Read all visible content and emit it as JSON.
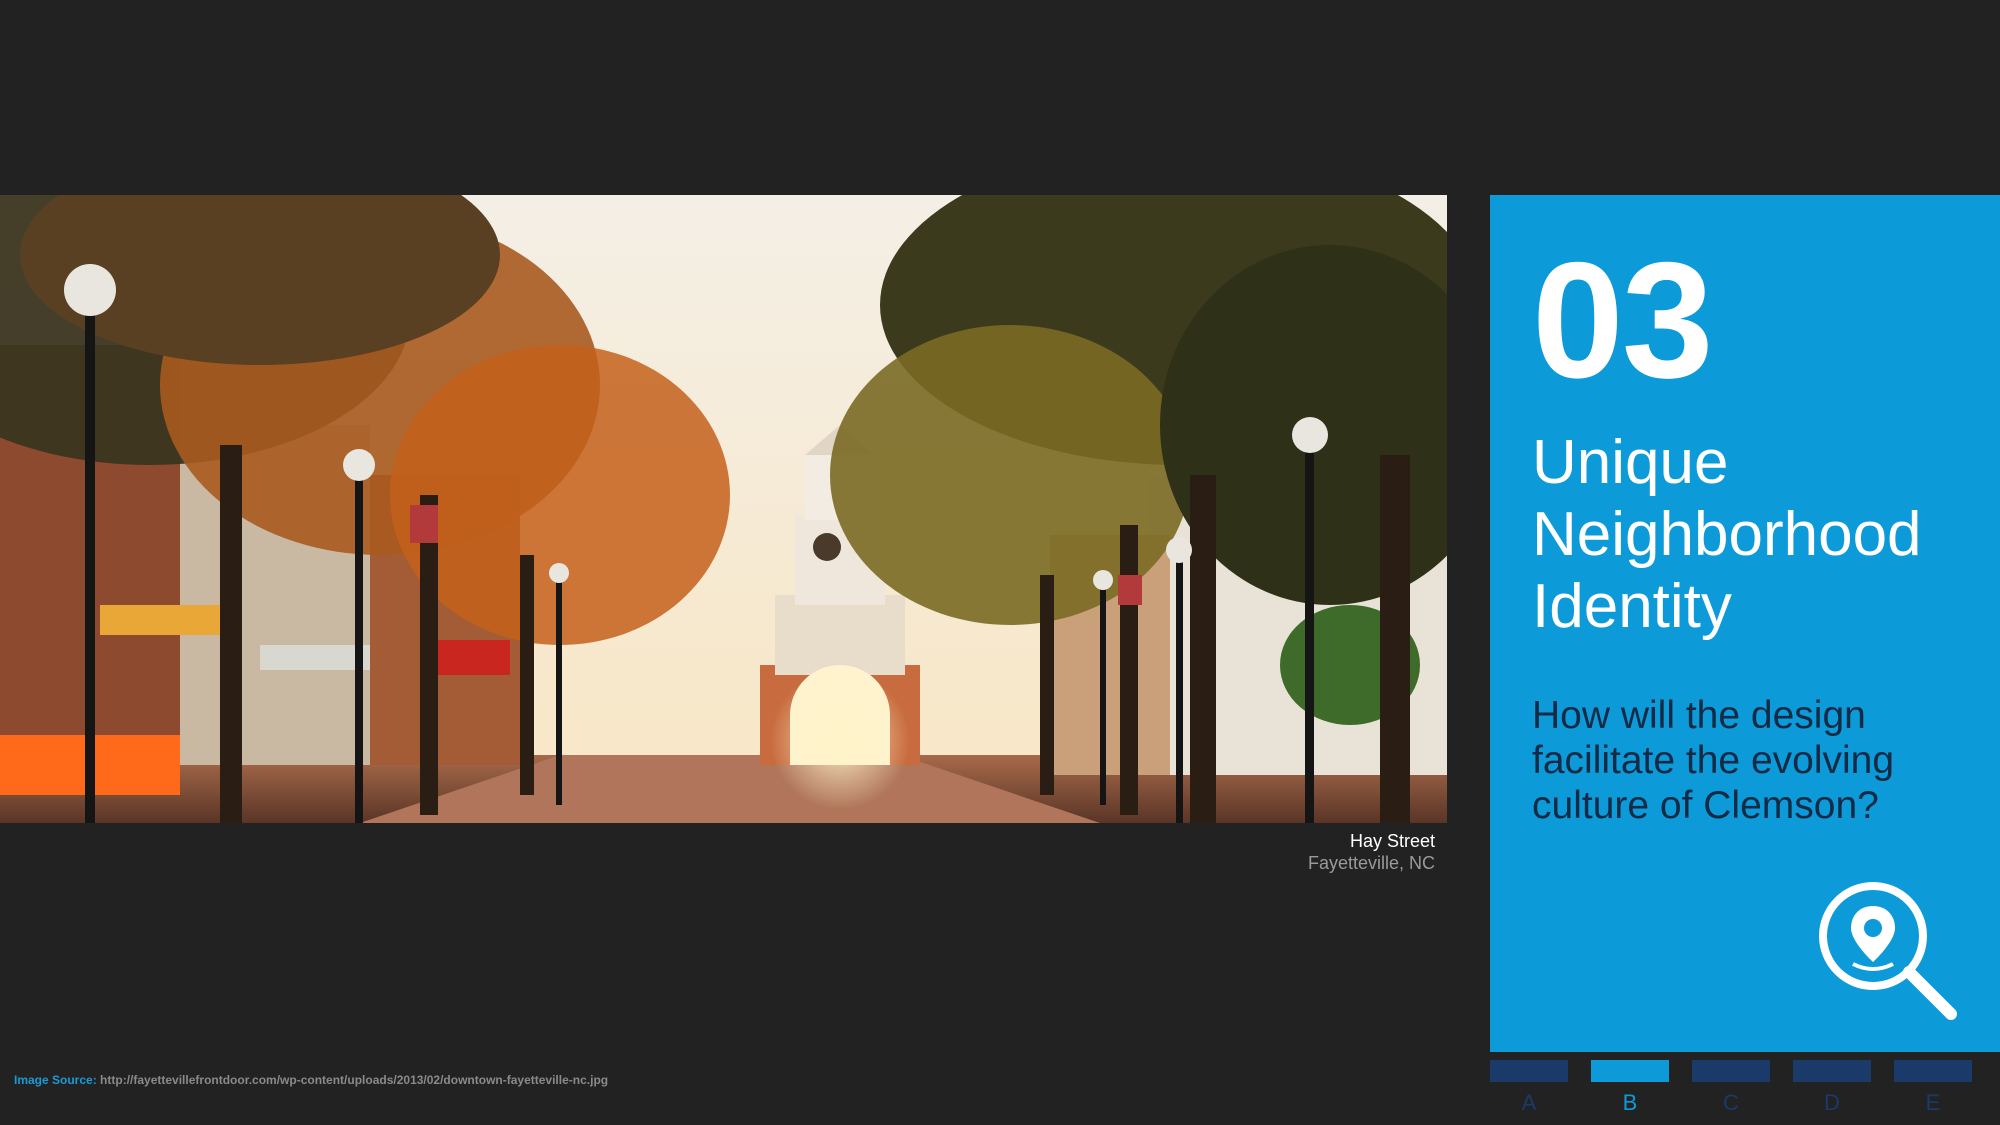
{
  "photo": {
    "alt_subject": "tree-lined street with clock tower"
  },
  "caption": {
    "title": "Hay Street",
    "subtitle": "Fayetteville, NC"
  },
  "panel": {
    "number": "03",
    "title_lines": [
      "Unique",
      "Neighborhood",
      "Identity"
    ],
    "question": "How will the design facilitate the evolving culture of Clemson?",
    "icon": "location-search-icon",
    "color": "#0c9ad9"
  },
  "nav": {
    "items": [
      {
        "label": "A",
        "active": false
      },
      {
        "label": "B",
        "active": true
      },
      {
        "label": "C",
        "active": false
      },
      {
        "label": "D",
        "active": false
      },
      {
        "label": "E",
        "active": false
      }
    ],
    "active_color": "#0c9ad9",
    "inactive_color": "#1a3a6a"
  },
  "source": {
    "label": "Image Source:",
    "url": "http://fayettevillefrontdoor.com/wp-content/uploads/2013/02/downtown-fayetteville-nc.jpg"
  }
}
